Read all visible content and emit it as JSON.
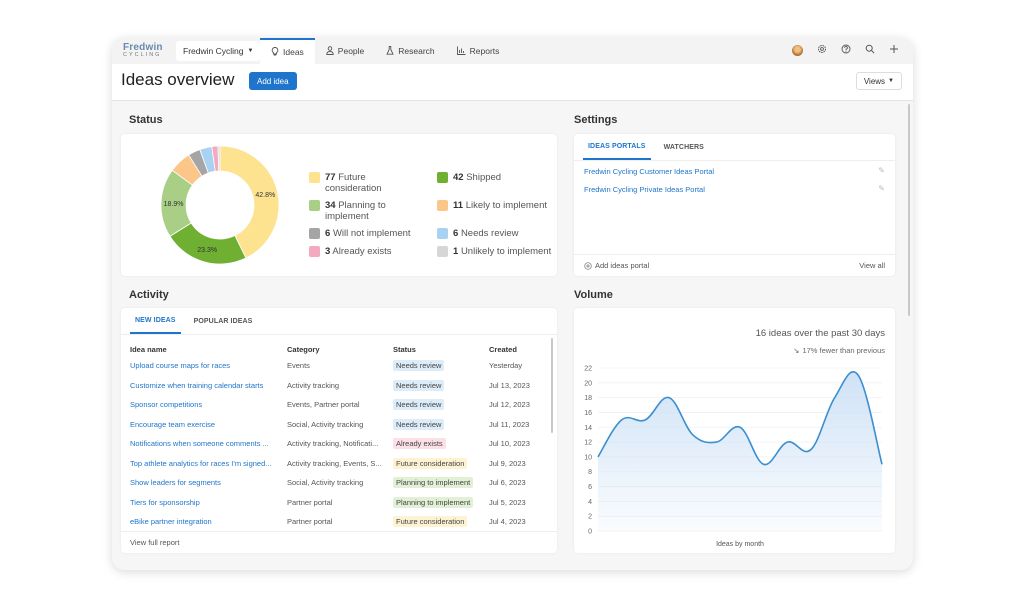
{
  "app": {
    "logo_top": "Fredwin",
    "logo_bottom": "CYCLING",
    "workspace": "Fredwin Cycling",
    "tabs": [
      {
        "label": "Ideas",
        "icon": "lightbulb-icon",
        "active": true
      },
      {
        "label": "People",
        "icon": "person-icon",
        "active": false
      },
      {
        "label": "Research",
        "icon": "flask-icon",
        "active": false
      },
      {
        "label": "Reports",
        "icon": "chart-icon",
        "active": false
      }
    ]
  },
  "header": {
    "title": "Ideas overview",
    "add_button": "Add idea",
    "views_button": "Views"
  },
  "status": {
    "title": "Status",
    "slices": [
      {
        "label": "Future consideration",
        "count": 77,
        "pct": 42.8,
        "pct_label": "42.8%",
        "color": "#fde38f"
      },
      {
        "label": "Shipped",
        "count": 42,
        "pct": 23.3,
        "pct_label": "23.3%",
        "color": "#6faf32"
      },
      {
        "label": "Planning to implement",
        "count": 34,
        "pct": 18.9,
        "pct_label": "18.9%",
        "color": "#a8cf85"
      },
      {
        "label": "Likely to implement",
        "count": 11,
        "pct": 6.1,
        "pct_label": "",
        "color": "#fcc689"
      },
      {
        "label": "Will not implement",
        "count": 6,
        "pct": 3.3,
        "pct_label": "",
        "color": "#a5a5a5"
      },
      {
        "label": "Needs review",
        "count": 6,
        "pct": 3.3,
        "pct_label": "",
        "color": "#a9d1f2"
      },
      {
        "label": "Already exists",
        "count": 3,
        "pct": 1.7,
        "pct_label": "",
        "color": "#f3a9c0"
      },
      {
        "label": "Unlikely to implement",
        "count": 1,
        "pct": 0.6,
        "pct_label": "",
        "color": "#d6d6d6"
      }
    ],
    "legend": [
      {
        "count": "77",
        "label": "Future",
        "label2": "consideration",
        "color": "#fde38f"
      },
      {
        "count": "42",
        "label": "Shipped",
        "label2": "",
        "color": "#6faf32"
      },
      {
        "count": "34",
        "label": "Planning to",
        "label2": "implement",
        "color": "#a8cf85"
      },
      {
        "count": "11",
        "label": "Likely to implement",
        "label2": "",
        "color": "#fcc689"
      },
      {
        "count": "6",
        "label": "Will not implement",
        "label2": "",
        "color": "#a5a5a5"
      },
      {
        "count": "6",
        "label": "Needs review",
        "label2": "",
        "color": "#a9d1f2"
      },
      {
        "count": "3",
        "label": "Already exists",
        "label2": "",
        "color": "#f3a9c0"
      },
      {
        "count": "1",
        "label": "Unlikely to implement",
        "label2": "",
        "color": "#d6d6d6"
      }
    ]
  },
  "settings": {
    "title": "Settings",
    "tabs": [
      "IDEAS PORTALS",
      "WATCHERS"
    ],
    "portals": [
      "Fredwin Cycling Customer Ideas Portal",
      "Fredwin Cycling Private Ideas Portal"
    ],
    "add_portal": "Add ideas portal",
    "view_all": "View all"
  },
  "activity": {
    "title": "Activity",
    "tabs": [
      "NEW IDEAS",
      "POPULAR IDEAS"
    ],
    "columns": [
      "Idea name",
      "Category",
      "Status",
      "Created"
    ],
    "rows": [
      {
        "name": "Upload course maps for races",
        "category": "Events",
        "status": "Needs review",
        "created": "Yesterday"
      },
      {
        "name": "Customize when training calendar starts",
        "category": "Activity tracking",
        "status": "Needs review",
        "created": "Jul 13, 2023"
      },
      {
        "name": "Sponsor competitions",
        "category": "Events, Partner portal",
        "status": "Needs review",
        "created": "Jul 12, 2023"
      },
      {
        "name": "Encourage team exercise",
        "category": "Social, Activity tracking",
        "status": "Needs review",
        "created": "Jul 11, 2023"
      },
      {
        "name": "Notifications when someone comments ...",
        "category": "Activity tracking, Notificati...",
        "status": "Already exists",
        "created": "Jul 10, 2023"
      },
      {
        "name": "Top athlete analytics for races I'm signed...",
        "category": "Activity tracking, Events, S...",
        "status": "Future consideration",
        "created": "Jul 9, 2023"
      },
      {
        "name": "Show leaders for segments",
        "category": "Social, Activity tracking",
        "status": "Planning to implement",
        "created": "Jul 6, 2023"
      },
      {
        "name": "Tiers for sponsorship",
        "category": "Partner portal",
        "status": "Planning to implement",
        "created": "Jul 5, 2023"
      },
      {
        "name": "eBike partner integration",
        "category": "Partner portal",
        "status": "Future consideration",
        "created": "Jul 4, 2023"
      }
    ],
    "status_colors": {
      "Needs review": "#dcecf9",
      "Already exists": "#fbe0e8",
      "Future consideration": "#fdf3d3",
      "Planning to implement": "#e2f1d6"
    },
    "footer": "View full report"
  },
  "volume": {
    "title": "Volume",
    "summary": "16 ideas over the past 30 days",
    "trend": "17% fewer than previous"
  },
  "chart_data": {
    "type": "area",
    "xlabel": "Ideas by month",
    "ylabel": "",
    "ylim": [
      0,
      22
    ],
    "yticks": [
      "0",
      "2",
      "4",
      "6",
      "8",
      "10",
      "12",
      "14",
      "16",
      "18",
      "20",
      "22"
    ],
    "x": [
      1,
      2,
      3,
      4,
      5,
      6,
      7,
      8,
      9,
      10,
      11,
      12,
      13
    ],
    "values": [
      10,
      15,
      15,
      18,
      13,
      12,
      14,
      9,
      12,
      11,
      18,
      21,
      9
    ],
    "grid": true,
    "line_color": "#3a8fd0",
    "fill_color": "#cfe2f6"
  }
}
